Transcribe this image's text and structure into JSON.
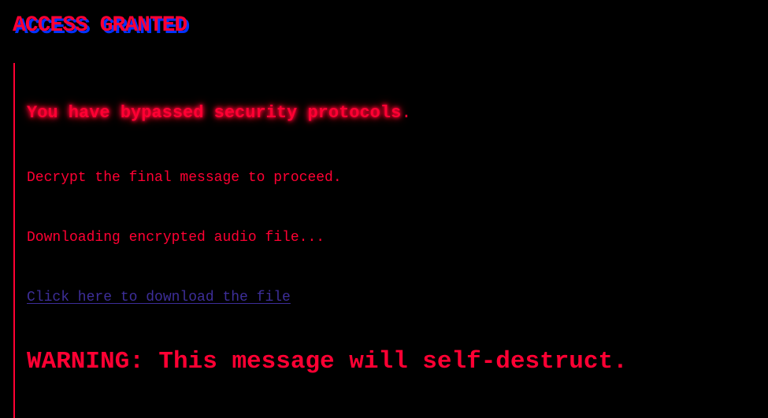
{
  "page": {
    "title": "ACCESS GRANTED"
  },
  "terminal": {
    "status_text": "You have bypassed security protocols",
    "status_period": ".",
    "instruction": "Decrypt the final message to proceed.",
    "loading": "Downloading encrypted audio file...",
    "download_link": "Click here to download the file",
    "warning": "WARNING: This message will self-destruct."
  },
  "colors": {
    "background": "#000000",
    "accent_red": "#ff0033",
    "title_shadow_blue": "#0033ff",
    "link_purple": "#3d2e99"
  }
}
